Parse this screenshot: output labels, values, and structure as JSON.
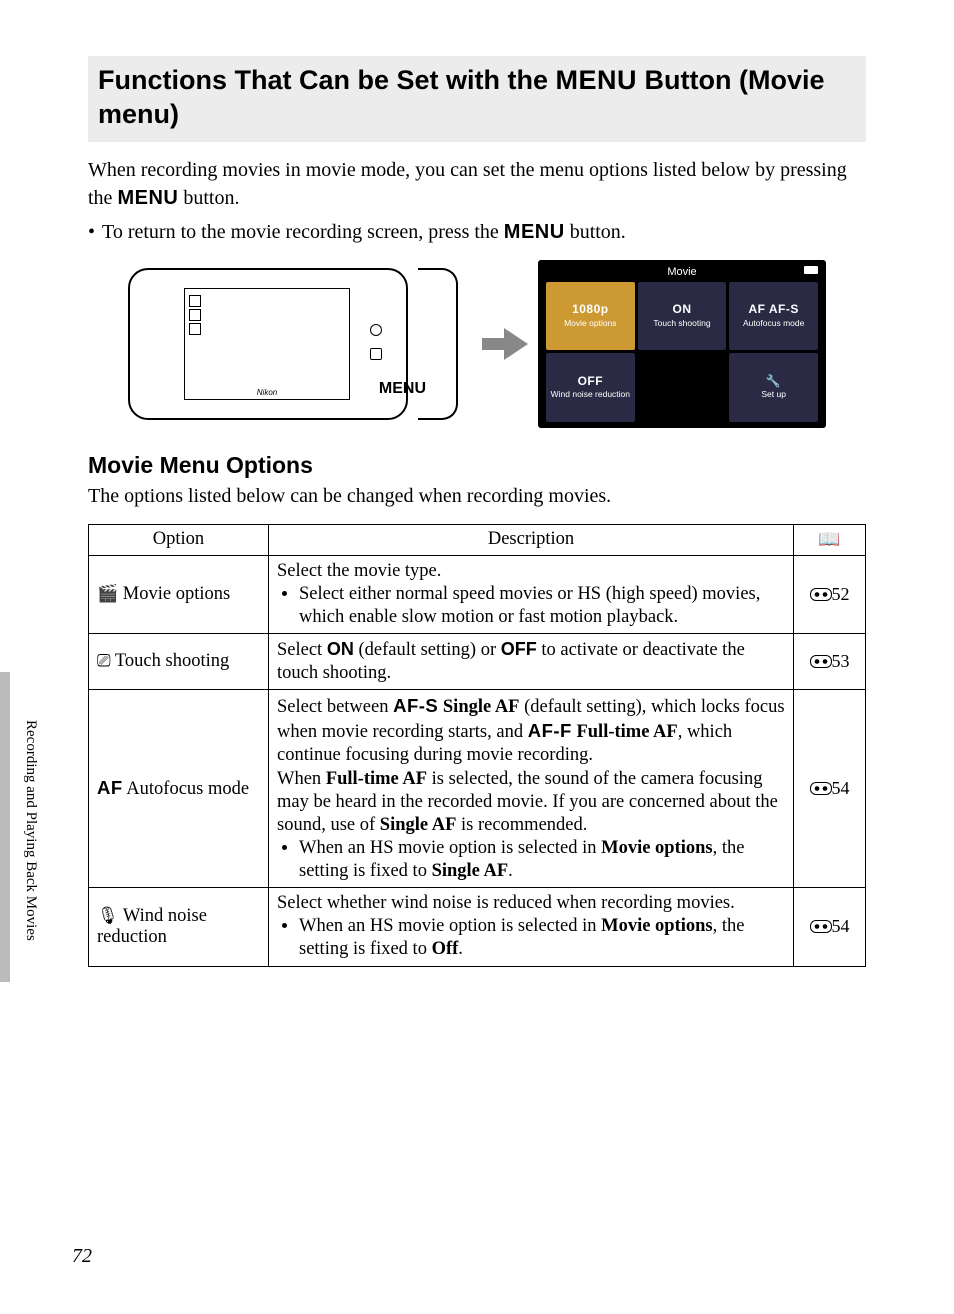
{
  "title_pre": "Functions That Can be Set with the ",
  "title_menu": "MENU",
  "title_post": " Button (Movie menu)",
  "intro_1": "When recording movies in movie mode, you can set the menu options listed below by pressing the ",
  "intro_2": " button.",
  "bullet_1a": "To return to the movie recording screen, press the ",
  "bullet_1b": " button.",
  "camera_brand": "Nikon",
  "menu_label_near_camera": "MENU",
  "menu_screen": {
    "header": "Movie",
    "tiles": [
      {
        "value": "1080p",
        "label": "Movie options",
        "sel": true
      },
      {
        "value": "ON",
        "label": "Touch shooting"
      },
      {
        "value": "AF  AF-S",
        "label": "Autofocus mode"
      },
      {
        "value": "OFF",
        "label": "Wind noise reduction"
      },
      {
        "value": "",
        "label": "",
        "empty": true
      },
      {
        "value": "🔧",
        "label": "Set up"
      }
    ]
  },
  "subheading": "Movie Menu Options",
  "sub_intro": "The options listed below can be changed when recording movies.",
  "table": {
    "headers": {
      "option": "Option",
      "description": "Description",
      "ref": "📖"
    },
    "rows": [
      {
        "icon": "🎬",
        "option": "Movie options",
        "desc_lead": "Select the movie type.",
        "desc_bullets": [
          "Select either normal speed movies or HS (high speed) movies, which enable slow motion or fast motion playback."
        ],
        "ref": "52"
      },
      {
        "icon": "⎚",
        "option": "Touch shooting",
        "desc_html": "Select <span class='small-label'>ON</span> (default setting) or <span class='small-label'>OFF</span> to activate or deactivate the touch shooting.",
        "ref": "53"
      },
      {
        "icon_text": "AF",
        "option": "Autofocus mode",
        "desc_html": "Select between <span class='af-glyph'>AF-S</span> <b>Single AF</b> (default setting), which locks focus when movie recording starts, and <span class='af-glyph'>AF-F</span> <b>Full-time AF</b>, which continue focusing during movie recording.<br>When <b>Full-time AF</b> is selected, the sound of the camera focusing may be heard in the recorded movie. If you are concerned about the sound, use of <b>Single AF</b> is recommended.",
        "desc_bullets_html": [
          "When an HS movie option is selected in <b>Movie options</b>, the setting is fixed to <b>Single AF</b>."
        ],
        "ref": "54"
      },
      {
        "icon": "🎙",
        "option": "Wind noise reduction",
        "desc_lead": "Select whether wind noise is reduced when recording movies.",
        "desc_bullets_html": [
          "When an HS movie option is selected in <b>Movie options</b>, the setting is fixed to <b>Off</b>."
        ],
        "ref": "54"
      }
    ]
  },
  "side_label": "Recording and Playing Back Movies",
  "page_number": "72"
}
